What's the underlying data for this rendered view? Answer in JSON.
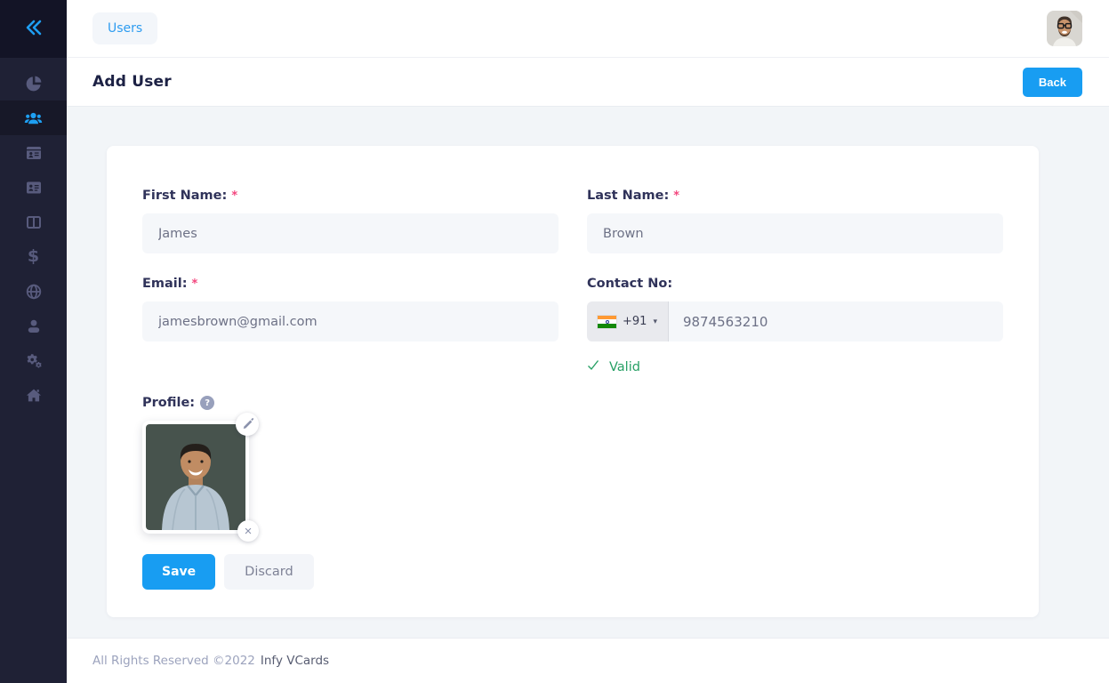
{
  "colors": {
    "accent": "#189df2",
    "valid_green": "#27a065",
    "required_marker_color": "#f3467e",
    "sidebar_bg": "#1f2135"
  },
  "topbar": {
    "breadcrumb": "Users"
  },
  "page_header": {
    "title": "Add User",
    "back_label": "Back"
  },
  "sidebar": {
    "collapse_icon": "double-chevron-left",
    "items": [
      {
        "icon": "pie-chart",
        "active": false
      },
      {
        "icon": "users",
        "active": true
      },
      {
        "icon": "vcard",
        "active": false
      },
      {
        "icon": "id-card",
        "active": false
      },
      {
        "icon": "columns",
        "active": false
      },
      {
        "icon": "dollar",
        "active": false
      },
      {
        "icon": "globe",
        "active": false
      },
      {
        "icon": "person",
        "active": false
      },
      {
        "icon": "gears",
        "active": false
      },
      {
        "icon": "home",
        "active": false
      }
    ],
    "dollar_glyph": "$"
  },
  "form": {
    "first_name": {
      "label": "First Name:",
      "required_marker": "*",
      "value": "James"
    },
    "last_name": {
      "label": "Last Name:",
      "required_marker": "*",
      "value": "Brown"
    },
    "email": {
      "label": "Email:",
      "required_marker": "*",
      "value": "jamesbrown@gmail.com"
    },
    "contact": {
      "label": "Contact No:",
      "dial_code": "+91",
      "caret": "▾",
      "value": "9874563210",
      "validation": "Valid"
    },
    "profile": {
      "label": "Profile:",
      "help_glyph": "?",
      "remove_glyph": "×"
    },
    "actions": {
      "save": "Save",
      "discard": "Discard"
    }
  },
  "footer": {
    "rights": "All Rights Reserved ©2022",
    "brand": "Infy VCards"
  }
}
